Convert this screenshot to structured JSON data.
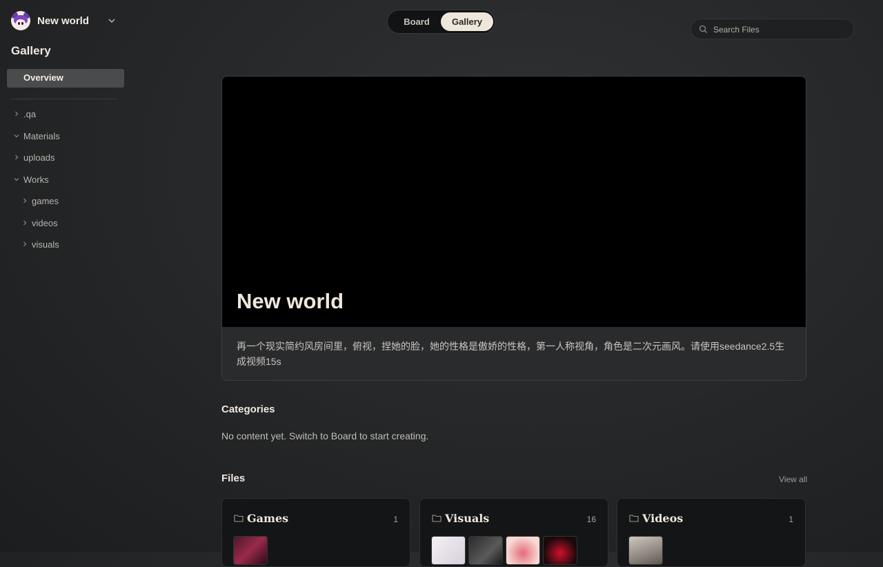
{
  "app": {
    "project_name": "New world",
    "logo_icon": "anime-girl-avatar"
  },
  "sidebar": {
    "title": "Gallery",
    "overview_label": "Overview",
    "items": [
      {
        "label": ".qa",
        "expanded": false,
        "depth": 0
      },
      {
        "label": "Materials",
        "expanded": true,
        "depth": 0
      },
      {
        "label": "uploads",
        "expanded": false,
        "depth": 0
      },
      {
        "label": "Works",
        "expanded": true,
        "depth": 0
      },
      {
        "label": "games",
        "expanded": false,
        "depth": 1
      },
      {
        "label": "videos",
        "expanded": false,
        "depth": 1
      },
      {
        "label": "visuals",
        "expanded": false,
        "depth": 1
      }
    ]
  },
  "view_switch": {
    "board_label": "Board",
    "gallery_label": "Gallery",
    "active": "Gallery"
  },
  "search": {
    "placeholder": "Search Files",
    "value": ""
  },
  "hero": {
    "title": "New world",
    "description": "再一个现实简约风房间里，俯视，捏她的脸，她的性格是傲娇的性格，第一人称视角，角色是二次元画风。请使用seedance2.5生成视频15s"
  },
  "categories": {
    "heading": "Categories",
    "empty_text": "No content yet. Switch to Board to start creating."
  },
  "files": {
    "heading": "Files",
    "view_all_label": "View all",
    "folders": [
      {
        "name": "Games",
        "count": "1"
      },
      {
        "name": "Visuals",
        "count": "16"
      },
      {
        "name": "Videos",
        "count": "1"
      }
    ]
  },
  "colors": {
    "accent_active": "#efe7db",
    "background": "#26282a",
    "card_bg": "#141516"
  }
}
